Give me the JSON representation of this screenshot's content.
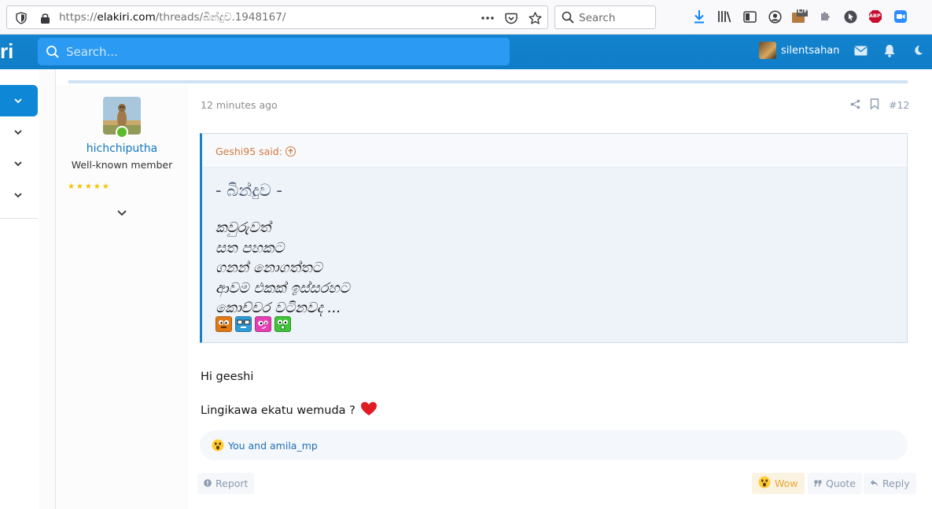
{
  "browser": {
    "url_prefix": "https://",
    "url_domain": "elakiri.com",
    "url_path": "/threads/බින්දුව.1948167/",
    "search_placeholder": "Search",
    "ext_badge": "L/F",
    "abp_label": "ABP"
  },
  "site": {
    "logo_fragment": "ri",
    "search_placeholder": "Search...",
    "username": "silentsahan"
  },
  "post": {
    "author": "hichchiputha",
    "author_title": "Well-known member",
    "stars": "★★★★★",
    "date": "12 minutes ago",
    "number": "#12",
    "quote": {
      "attribution": "Geshi95 said:",
      "title": "- බින්දුව -",
      "lines": [
        "කවුරුවත්",
        "සත පහකට",
        "ගනන් නොගත්තට",
        "ආවම එකක් ඉස්සරහට",
        "කොච්චර වටිනවද ..."
      ]
    },
    "message_line1": "Hi geeshi",
    "message_line2": "Lingikawa ekatu wemuda ?",
    "reactions_text": "You and amila_mp",
    "buttons": {
      "report": "Report",
      "wow": "Wow",
      "quote": "Quote",
      "reply": "Reply"
    }
  },
  "colors": {
    "header_blue": "#0f7dc7",
    "link_blue": "#1177c1",
    "quote_attribution": "#d37a3b",
    "online_green": "#5dbb2b"
  }
}
